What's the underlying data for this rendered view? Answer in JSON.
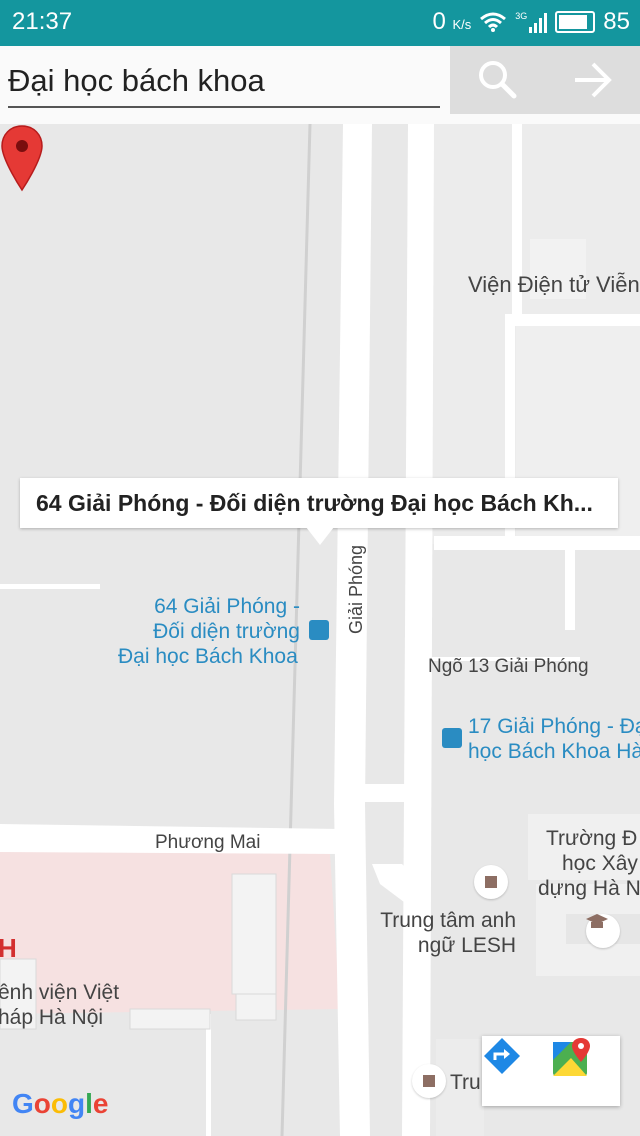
{
  "status_bar": {
    "time": "21:37",
    "network_speed": "0",
    "network_unit": "K/s",
    "signal_type": "3G",
    "battery": "85"
  },
  "search": {
    "value": "Đại học bách khoa",
    "search_icon": "search-icon",
    "go_icon": "arrow-right-icon"
  },
  "map": {
    "callout_title": "64 Giải Phóng - Đối diện trường Đại học Bách Kh...",
    "selected_stop": [
      "64 Giải Phóng -",
      "Đối diện trường",
      "Đại học Bách Khoa"
    ],
    "street_giai_phong": "Giải Phóng",
    "alley_13": "Ngõ 13 Giải Phóng",
    "street_phuong_mai": "Phương Mai",
    "vien_dien_tu": "Viện Điện tử Viễn",
    "stop_17": [
      "17 Giải Phóng - Đạ",
      "học Bách Khoa Hà"
    ],
    "truong_xay_dung": [
      "Trường Đ",
      "học Xây",
      "dựng Hà N"
    ],
    "trung_tam_lesh": [
      "Trung tâm anh",
      "ngữ LESH"
    ],
    "benh_vien": [
      "ênh viện Việt",
      "háp Hà Nội"
    ],
    "trung_tam_viet": "Trung Tâm Việt",
    "hospital_letter": "H",
    "google": "Google"
  },
  "colors": {
    "status_bar": "#14969e",
    "bus_stop": "#2a8cc2",
    "marker": "#e53935",
    "hospital_area": "#f6e1e1"
  }
}
